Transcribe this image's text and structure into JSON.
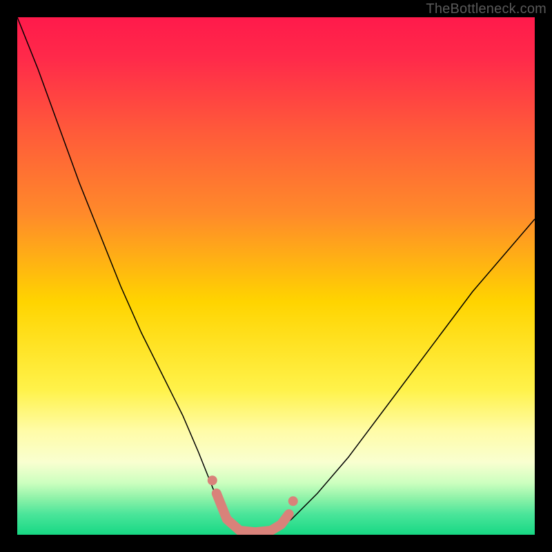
{
  "watermark": "TheBottleneck.com",
  "chart_data": {
    "type": "line",
    "title": "",
    "xlabel": "",
    "ylabel": "",
    "xlim": [
      0,
      100
    ],
    "ylim": [
      0,
      100
    ],
    "background_gradient": {
      "stops": [
        {
          "pos": 0.0,
          "color": "#ff1a4b"
        },
        {
          "pos": 0.08,
          "color": "#ff2a4a"
        },
        {
          "pos": 0.22,
          "color": "#ff5a3a"
        },
        {
          "pos": 0.38,
          "color": "#ff8a2a"
        },
        {
          "pos": 0.55,
          "color": "#ffd400"
        },
        {
          "pos": 0.72,
          "color": "#fff24a"
        },
        {
          "pos": 0.8,
          "color": "#fffca8"
        },
        {
          "pos": 0.86,
          "color": "#f9ffd0"
        },
        {
          "pos": 0.9,
          "color": "#ccffbf"
        },
        {
          "pos": 0.93,
          "color": "#8df2a8"
        },
        {
          "pos": 0.96,
          "color": "#4be59a"
        },
        {
          "pos": 1.0,
          "color": "#17d884"
        }
      ]
    },
    "series": [
      {
        "name": "bottleneck-curve",
        "stroke": "#000000",
        "stroke_width": 1.5,
        "x": [
          0,
          4,
          8,
          12,
          16,
          20,
          24,
          28,
          32,
          35,
          37,
          39,
          40,
          42,
          45,
          48,
          50,
          53,
          58,
          64,
          70,
          76,
          82,
          88,
          94,
          100
        ],
        "values": [
          100,
          90,
          79,
          68,
          58,
          48,
          39,
          31,
          23,
          16,
          11,
          6,
          3,
          1,
          0,
          0,
          1,
          3,
          8,
          15,
          23,
          31,
          39,
          47,
          54,
          61
        ]
      }
    ],
    "highlight": {
      "name": "optimal-zone",
      "stroke": "#d9827a",
      "stroke_width": 14,
      "points_x": [
        38.5,
        40.5,
        43,
        46,
        49,
        51,
        52.5
      ],
      "points_y": [
        8,
        3,
        0.8,
        0.5,
        0.8,
        2,
        4
      ]
    }
  }
}
